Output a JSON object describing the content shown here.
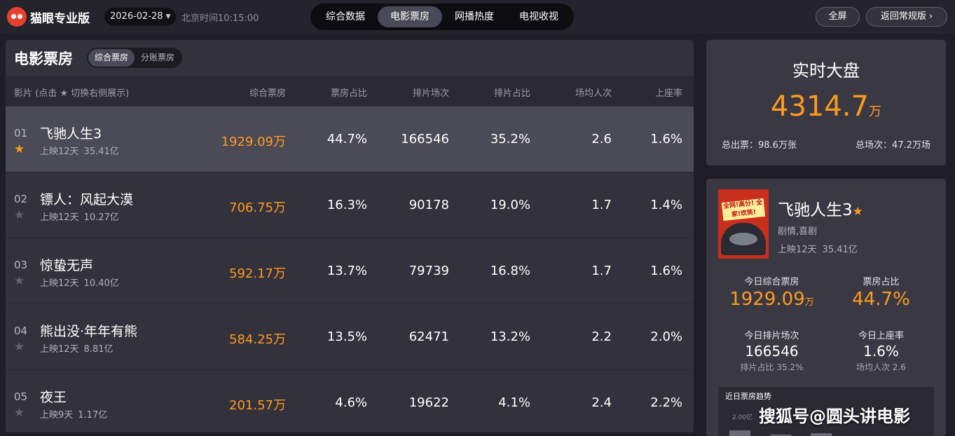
{
  "app": {
    "logo_text": "猫眼专业版",
    "date": "2026-02-28",
    "clock": "北京时间10:15:00"
  },
  "nav": {
    "tabs": [
      "综合数据",
      "电影票房",
      "网播热度",
      "电视收视"
    ],
    "active": 1
  },
  "actions": {
    "fullscreen": "全屏",
    "back": "返回常规版"
  },
  "panel": {
    "title": "电影票房",
    "segments": [
      "综合票房",
      "分账票房"
    ],
    "headers": {
      "film": "影片 (点击 ★ 切换右侧展示)",
      "box_office": "综合票房",
      "bo_share": "票房占比",
      "shows": "排片场次",
      "show_share": "排片占比",
      "avg_people": "场均人次",
      "occupancy": "上座率"
    }
  },
  "films": [
    {
      "rank": "01",
      "name": "飞驰人生3",
      "days": "上映12天",
      "total": "35.41亿",
      "box_office": "1929.09万",
      "bo_share": "44.7%",
      "shows": "166546",
      "show_share": "35.2%",
      "avg_people": "2.6",
      "occupancy": "1.6%",
      "starred": true
    },
    {
      "rank": "02",
      "name": "镖人：风起大漠",
      "days": "上映12天",
      "total": "10.27亿",
      "box_office": "706.75万",
      "bo_share": "16.3%",
      "shows": "90178",
      "show_share": "19.0%",
      "avg_people": "1.7",
      "occupancy": "1.4%",
      "starred": false
    },
    {
      "rank": "03",
      "name": "惊蛰无声",
      "days": "上映12天",
      "total": "10.40亿",
      "box_office": "592.17万",
      "bo_share": "13.7%",
      "shows": "79739",
      "show_share": "16.8%",
      "avg_people": "1.7",
      "occupancy": "1.6%",
      "starred": false
    },
    {
      "rank": "04",
      "name": "熊出没·年年有熊",
      "days": "上映12天",
      "total": "8.81亿",
      "box_office": "584.25万",
      "bo_share": "13.5%",
      "shows": "62471",
      "show_share": "13.2%",
      "avg_people": "2.2",
      "occupancy": "2.0%",
      "starred": false
    },
    {
      "rank": "05",
      "name": "夜王",
      "days": "上映9天",
      "total": "1.17亿",
      "box_office": "201.57万",
      "bo_share": "4.6%",
      "shows": "19622",
      "show_share": "4.1%",
      "avg_people": "2.4",
      "occupancy": "2.2%",
      "starred": false
    }
  ],
  "realtime": {
    "title": "实时大盘",
    "value": "4314.7",
    "unit": "万",
    "tickets": "总出票：98.6万张",
    "shows": "总场次：47.2万场"
  },
  "detail": {
    "name": "飞驰人生3",
    "genre": "剧情,喜剧",
    "days": "上映12天",
    "total": "35.41亿",
    "poster_tag": "全网!高分! 全家!欢笑!",
    "today_bo_label": "今日综合票房",
    "today_bo_value": "1929.09",
    "today_bo_unit": "万",
    "bo_share_label": "票房占比",
    "bo_share_value": "44.7%",
    "shows_label": "今日排片场次",
    "shows_value": "166546",
    "shows_sub": "排片占比 35.2%",
    "occupancy_label": "今日上座率",
    "occupancy_value": "1.6%",
    "occupancy_sub": "场均人次 2.6",
    "trend_label": "近日票房趋势",
    "trend_tick": "2.00亿"
  },
  "watermark": "搜狐号@圆头讲电影",
  "colors": {
    "accent": "#ff9a1f",
    "star": "#f59e1d",
    "highlight_row": "#4b4a57",
    "brand_red": "#e8402e"
  }
}
